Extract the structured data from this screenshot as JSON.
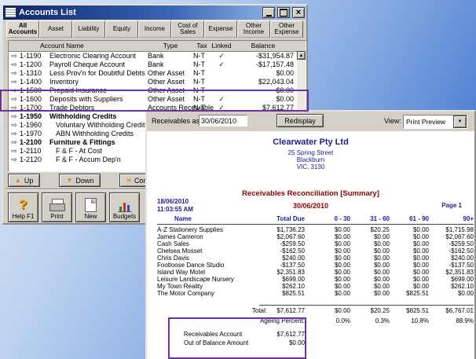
{
  "icons": {
    "close": "×",
    "scroll_up": "▲",
    "scroll_down": "▼",
    "dropdown": "▼",
    "zoom_arrow": "⇨",
    "check": "✓"
  },
  "annotation_color": "#7030a0",
  "accounts_window": {
    "title": "Accounts List",
    "tabs": [
      {
        "label": "All Accounts",
        "active": true
      },
      {
        "label": "Asset",
        "active": false
      },
      {
        "label": "Liability",
        "active": false
      },
      {
        "label": "Equity",
        "active": false
      },
      {
        "label": "Income",
        "active": false
      },
      {
        "label": "Cost of Sales",
        "active": false
      },
      {
        "label": "Expense",
        "active": false
      },
      {
        "label": "Other Income",
        "active": false
      },
      {
        "label": "Other Expense",
        "active": false
      }
    ],
    "columns": [
      "Account Name",
      "Type",
      "Tax",
      "Linked",
      "Balance"
    ],
    "rows": [
      {
        "number": "1-1190",
        "name": "Electronic Clearing Account",
        "type": "Bank",
        "tax": "N-T",
        "linked": true,
        "balance": "-$31,954.87",
        "bold": false,
        "indent": 0
      },
      {
        "number": "1-1200",
        "name": "Payroll Cheque Account",
        "type": "Bank",
        "tax": "N-T",
        "linked": true,
        "balance": "-$17,157.48",
        "bold": false,
        "indent": 0
      },
      {
        "number": "1-1310",
        "name": "Less Prov'n for Doubtful Debts",
        "type": "Other Asset",
        "tax": "N-T",
        "linked": false,
        "balance": "$0.00",
        "bold": false,
        "indent": 0
      },
      {
        "number": "1-1400",
        "name": "Inventory",
        "type": "Other Asset",
        "tax": "N-T",
        "linked": false,
        "balance": "$22,043.04",
        "bold": false,
        "indent": 0
      },
      {
        "number": "1-1500",
        "name": "Prepaid Insurance",
        "type": "Other Asset",
        "tax": "N-T",
        "linked": false,
        "balance": "$0.00",
        "bold": false,
        "indent": 0
      },
      {
        "number": "1-1600",
        "name": "Deposits with Suppliers",
        "type": "Other Asset",
        "tax": "N-T",
        "linked": true,
        "balance": "$0.00",
        "bold": false,
        "indent": 0
      },
      {
        "number": "1-1700",
        "name": "Trade Debtors",
        "type": "Accounts Receivable",
        "tax": "N-T",
        "linked": true,
        "balance": "$7,612.77",
        "bold": false,
        "indent": 0
      },
      {
        "number": "1-1950",
        "name": "Withholding Credits",
        "type": "",
        "tax": "",
        "linked": false,
        "balance": "",
        "bold": true,
        "indent": 0
      },
      {
        "number": "1-1960",
        "name": "Voluntary Withholding Credits",
        "type": "",
        "tax": "",
        "linked": false,
        "balance": "",
        "bold": false,
        "indent": 1
      },
      {
        "number": "1-1970",
        "name": "ABN Withholding Credits",
        "type": "",
        "tax": "",
        "linked": false,
        "balance": "",
        "bold": false,
        "indent": 1
      },
      {
        "number": "1-2100",
        "name": "Furniture & Fittings",
        "type": "",
        "tax": "",
        "linked": false,
        "balance": "",
        "bold": true,
        "indent": 0
      },
      {
        "number": "1-2110",
        "name": "F & F - At Cost",
        "type": "",
        "tax": "",
        "linked": false,
        "balance": "",
        "bold": false,
        "indent": 1
      },
      {
        "number": "1-2120",
        "name": "F & F - Accum Dep'n",
        "type": "",
        "tax": "",
        "linked": false,
        "balance": "",
        "bold": false,
        "indent": 1
      }
    ],
    "action_buttons": [
      {
        "label": "Up",
        "icon": "up-arrow"
      },
      {
        "label": "Down",
        "icon": "down-arrow"
      },
      {
        "label": "Combine",
        "icon": "combine"
      }
    ],
    "toolbar_buttons": [
      {
        "label": "Help F1",
        "icon": "help"
      },
      {
        "label": "Print",
        "icon": "printer"
      },
      {
        "label": "New",
        "icon": "new-document"
      },
      {
        "label": "Budgets",
        "icon": "budgets"
      }
    ]
  },
  "report_window": {
    "toolbar": {
      "as_of_label": "Receivables as of:",
      "as_of_value": "30/06/2010",
      "redisplay_label": "Redisplay",
      "view_label": "View:",
      "view_value": "Print Preview"
    },
    "company": {
      "name": "Clearwater Pty Ltd",
      "line1": "25 Spring Street",
      "line2": "Blackburn",
      "line3": "VIC, 3130"
    },
    "report_title": "Receivables Reconciliation [Summary]",
    "report_date": "30/06/2010",
    "printed_date": "18/06/2010",
    "printed_time": "11:03:55 AM",
    "page_label": "Page 1",
    "columns": [
      "Name",
      "Total Due",
      "0 - 30",
      "31 - 60",
      "61 - 90",
      "90+"
    ],
    "rows": [
      {
        "name": "A-Z Stationery Supplies",
        "values": [
          "$1,736.23",
          "$0.00",
          "$20.25",
          "$0.00",
          "$1,715.98"
        ]
      },
      {
        "name": "James Cameron",
        "values": [
          "$2,067.60",
          "$0.00",
          "$0.00",
          "$0.00",
          "$2,067.60"
        ]
      },
      {
        "name": "Cash Sales",
        "values": [
          "-$259.50",
          "$0.00",
          "$0.00",
          "$0.00",
          "-$259.50"
        ]
      },
      {
        "name": "Chelsea Mosset",
        "values": [
          "-$162.50",
          "$0.00",
          "$0.00",
          "$0.00",
          "-$162.50"
        ]
      },
      {
        "name": "Chris Davis",
        "values": [
          "$240.00",
          "$0.00",
          "$0.00",
          "$0.00",
          "$240.00"
        ]
      },
      {
        "name": "Footloose Dance Studio",
        "values": [
          "-$137.50",
          "$0.00",
          "$0.00",
          "$0.00",
          "-$137.50"
        ]
      },
      {
        "name": "Island Way Motel",
        "values": [
          "$2,351.83",
          "$0.00",
          "$0.00",
          "$0.00",
          "$2,351.83"
        ]
      },
      {
        "name": "Leisure Landscape Nursery",
        "values": [
          "$699.00",
          "$0.00",
          "$0.00",
          "$0.00",
          "$699.00"
        ]
      },
      {
        "name": "My Town Reality",
        "values": [
          "$262.10",
          "$0.00",
          "$0.00",
          "$0.00",
          "$262.10"
        ]
      },
      {
        "name": "The Motor Company",
        "values": [
          "$825.51",
          "$0.00",
          "$0.00",
          "$825.51",
          "$0.00"
        ]
      }
    ],
    "total_label": "Total:",
    "totals": [
      "$7,612.77",
      "$0.00",
      "$20.25",
      "$825.51",
      "$6,767.01"
    ],
    "ageing_label": "Ageing Percent:",
    "ageing": [
      "0.0%",
      "0.3%",
      "10.8%",
      "88.9%"
    ],
    "summary": [
      {
        "label": "Receivables Account",
        "value": "$7,612.77"
      },
      {
        "label": "Out of Balance Amount",
        "value": "$0.00"
      }
    ]
  }
}
